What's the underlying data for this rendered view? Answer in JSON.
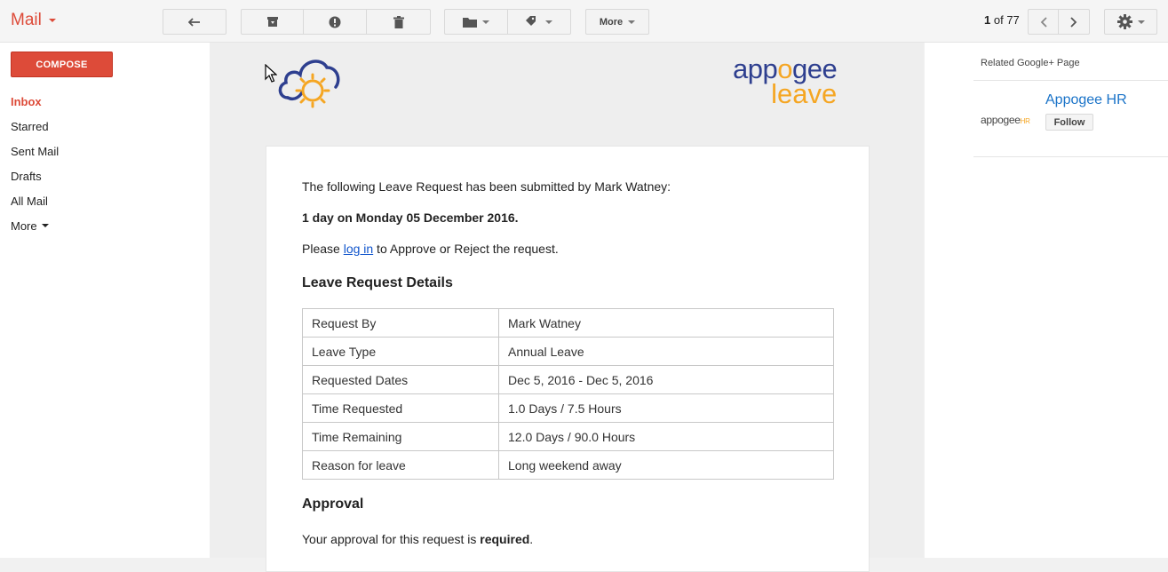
{
  "header": {
    "app_label": "Mail",
    "more_label": "More",
    "pager": {
      "current": "1",
      "of_label": "of",
      "total": "77"
    }
  },
  "leftnav": {
    "compose_label": "COMPOSE",
    "items": [
      {
        "label": "Inbox"
      },
      {
        "label": "Starred"
      },
      {
        "label": "Sent Mail"
      },
      {
        "label": "Drafts"
      },
      {
        "label": "All Mail"
      },
      {
        "label": "More"
      }
    ]
  },
  "email": {
    "brand_line1_a": "app",
    "brand_line1_o": "o",
    "brand_line1_b": "gee",
    "brand_line2": "leave",
    "intro": "The following Leave Request has been submitted by Mark Watney:",
    "summary": "1 day on Monday 05 December 2016.",
    "cta_prefix": "Please ",
    "cta_link": "log in",
    "cta_suffix": " to Approve or Reject the request.",
    "details_heading": "Leave Request Details",
    "details": [
      {
        "label": "Request By",
        "value": "Mark Watney"
      },
      {
        "label": "Leave Type",
        "value": "Annual Leave"
      },
      {
        "label": "Requested Dates",
        "value": "Dec 5, 2016 - Dec 5, 2016"
      },
      {
        "label": "Time Requested",
        "value": "1.0 Days / 7.5 Hours"
      },
      {
        "label": "Time Remaining",
        "value": "12.0 Days / 90.0 Hours"
      },
      {
        "label": "Reason for leave",
        "value": "Long weekend away"
      }
    ],
    "approval_heading": "Approval",
    "approval_prefix": "Your approval for this request is ",
    "approval_bold": "required",
    "approval_suffix": "."
  },
  "rightpanel": {
    "related_label": "Related Google+ Page",
    "mini_logo": "appogee",
    "mini_logo_suffix": "HR",
    "page_name": "Appogee HR",
    "follow_label": "Follow"
  }
}
